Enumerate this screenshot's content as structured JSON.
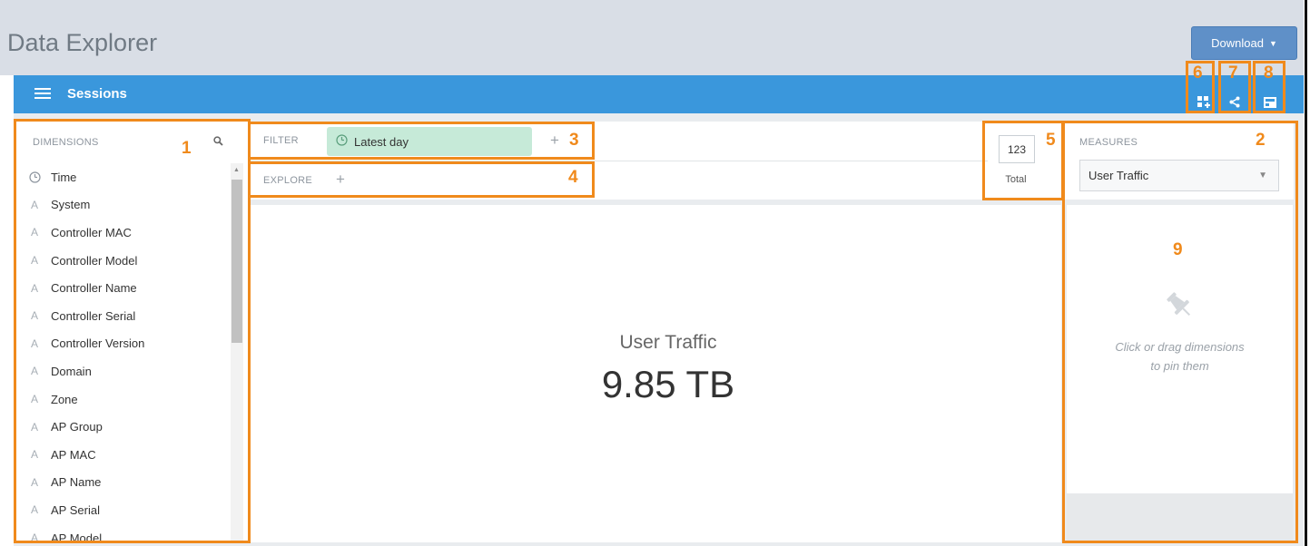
{
  "app": {
    "title": "Data Explorer"
  },
  "toolbar": {
    "download_label": "Download"
  },
  "cube_bar": {
    "title": "Sessions"
  },
  "annotations": {
    "dimensions_panel": "1",
    "measures_panel": "2",
    "filter_bar": "3",
    "explore_bar": "4",
    "total_view": "5",
    "visualization_selector": "6",
    "share": "7",
    "pin_board_toggle": "8",
    "pin_board": "9"
  },
  "dimensions": {
    "header": "DIMENSIONS",
    "items": [
      {
        "label": "Time",
        "icon": "clock-icon"
      },
      {
        "label": "System",
        "icon": "string-dimension-icon"
      },
      {
        "label": "Controller MAC",
        "icon": "string-dimension-icon"
      },
      {
        "label": "Controller Model",
        "icon": "string-dimension-icon"
      },
      {
        "label": "Controller Name",
        "icon": "string-dimension-icon"
      },
      {
        "label": "Controller Serial",
        "icon": "string-dimension-icon"
      },
      {
        "label": "Controller Version",
        "icon": "string-dimension-icon"
      },
      {
        "label": "Domain",
        "icon": "string-dimension-icon"
      },
      {
        "label": "Zone",
        "icon": "string-dimension-icon"
      },
      {
        "label": "AP Group",
        "icon": "string-dimension-icon"
      },
      {
        "label": "AP MAC",
        "icon": "string-dimension-icon"
      },
      {
        "label": "AP Name",
        "icon": "string-dimension-icon"
      },
      {
        "label": "AP Serial",
        "icon": "string-dimension-icon"
      },
      {
        "label": "AP Model",
        "icon": "string-dimension-icon"
      }
    ]
  },
  "filter": {
    "label": "FILTER",
    "chip": "Latest day"
  },
  "explore": {
    "label": "EXPLORE"
  },
  "total": {
    "icon_text": "123",
    "label": "Total"
  },
  "measures": {
    "header": "MEASURES",
    "selected": "User Traffic"
  },
  "visualization": {
    "measure": "User Traffic",
    "value": "9.85 TB"
  },
  "pin_board": {
    "line1": "Click or drag dimensions",
    "line2": "to pin them"
  },
  "colors": {
    "accent_blue": "#3a97dc",
    "annotation_orange": "#f08a1c",
    "filter_chip_green": "#c6ead8",
    "download_blue": "#5f90c8"
  }
}
